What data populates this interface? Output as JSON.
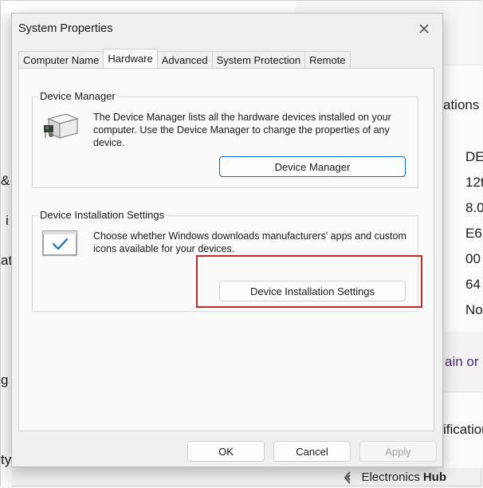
{
  "background": {
    "right_texts": [
      "ations",
      "DE",
      "12t",
      "8.0",
      "E6",
      "00",
      "64",
      "No"
    ],
    "right_link": "ain or",
    "right_text_lower": "ification",
    "left_chars": [
      "&",
      "i",
      "at",
      "g",
      "ty"
    ]
  },
  "dialog": {
    "title": "System Properties",
    "close_icon": "close-icon",
    "tabs": [
      "Computer Name",
      "Hardware",
      "Advanced",
      "System Protection",
      "Remote"
    ],
    "active_tab": "Hardware",
    "device_manager": {
      "group_label": "Device Manager",
      "description": "The Device Manager lists all the hardware devices installed on your computer. Use the Device Manager to change the properties of any device.",
      "button_label": "Device Manager",
      "icon": "device-manager-icon"
    },
    "device_installation": {
      "group_label": "Device Installation Settings",
      "description": "Choose whether Windows downloads manufacturers' apps and custom icons available for your devices.",
      "button_label": "Device Installation Settings",
      "icon": "monitor-check-icon"
    },
    "footer": {
      "ok_label": "OK",
      "cancel_label": "Cancel",
      "apply_label": "Apply"
    },
    "highlight_color": "#c0272d",
    "accent_color": "#0f6cbd"
  },
  "watermark": {
    "brand_a": "Electronics",
    "brand_b": "Hub"
  }
}
